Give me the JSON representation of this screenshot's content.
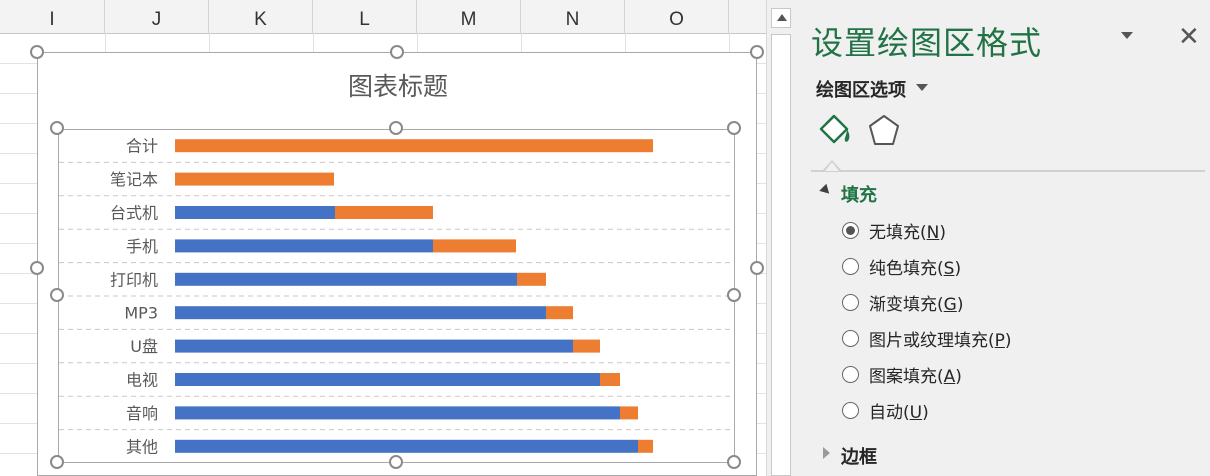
{
  "sheet": {
    "columns": [
      "I",
      "J",
      "K",
      "L",
      "M",
      "N",
      "O"
    ]
  },
  "chart": {
    "title": "图表标题",
    "colors": {
      "series1": "#4472c4",
      "series2": "#ed7d31"
    }
  },
  "chart_data": {
    "type": "bar",
    "orientation": "horizontal",
    "stacked": true,
    "categories": [
      "合计",
      "笔记本",
      "台式机",
      "手机",
      "打印机",
      "MP3",
      "U盘",
      "电视",
      "音响",
      "其他"
    ],
    "series": [
      {
        "values": [
          0,
          0,
          160,
          258,
          342,
          371,
          398,
          425,
          445,
          463
        ]
      },
      {
        "values": [
          478,
          159,
          98,
          83,
          29,
          27,
          27,
          20,
          18,
          15
        ]
      }
    ],
    "xlim": [
      0,
      560
    ],
    "grid": true,
    "legend": "none",
    "title": "图表标题"
  },
  "pane": {
    "title": "设置绘图区格式",
    "options_label": "绘图区选项",
    "tab_fill_icon": "paint-bucket-icon",
    "tab_shape_icon": "pentagon-icon",
    "fill_section": "填充",
    "border_section": "边框",
    "fill_options": [
      {
        "text": "无填充(",
        "key": "N",
        "close": ")",
        "checked": true
      },
      {
        "text": "纯色填充(",
        "key": "S",
        "close": ")",
        "checked": false
      },
      {
        "text": "渐变填充(",
        "key": "G",
        "close": ")",
        "checked": false
      },
      {
        "text": "图片或纹理填充(",
        "key": "P",
        "close": ")",
        "checked": false
      },
      {
        "text": "图案填充(",
        "key": "A",
        "close": ")",
        "checked": false
      },
      {
        "text": "自动(",
        "key": "U",
        "close": ")",
        "checked": false
      }
    ],
    "accent": "#217346"
  }
}
